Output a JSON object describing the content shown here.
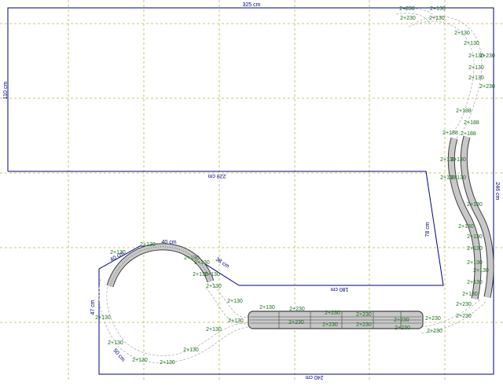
{
  "plan": {
    "colors": {
      "background": "#ffffff",
      "grid": "#b8b84a",
      "outline": "#000080",
      "dimension_text": "#000080",
      "track_label": "#1a6b1a",
      "track_ghost": "#b0b0b0",
      "track_fill": "#c8c8c8",
      "track_edge": "#404040"
    },
    "dimensions": {
      "top_width": "325 cm",
      "left_height": "110 cm",
      "inner_width": "229 cm",
      "right_height": "246 cm",
      "notch_height": "78 cm",
      "notch_width": "180 cm",
      "bottom_width": "240 cm",
      "left_lower_height": "47 cm",
      "loop_radius": "40 cm",
      "diag_top": "40 cm",
      "diag_right": "38 cm",
      "diag_bottom": "50 cm"
    },
    "track_labels": [
      "2+230",
      "2+130",
      "2+230",
      "2+130",
      "2+130",
      "2+130",
      "2+130",
      "2+230",
      "2+130",
      "2+130",
      "2+230",
      "2+188",
      "2+188",
      "2+188",
      "2+188",
      "2+130",
      "2+130",
      "2+130",
      "2+130",
      "2+130",
      "2+130",
      "2+130",
      "2+130",
      "2+130",
      "2+130",
      "2+130",
      "2+130",
      "2+130",
      "2+130",
      "2+130",
      "2+130",
      "2+130",
      "2+130",
      "2+130",
      "2+130",
      "2+130",
      "2+230",
      "2+230",
      "2+230",
      "2+230",
      "2+230",
      "2+230",
      "2+230",
      "2+230",
      "2+230",
      "2+230",
      "2+230",
      "2+230",
      "2+130",
      "2+130",
      "2+130",
      "2+130",
      "2+130",
      "2+130",
      "2+130"
    ]
  }
}
